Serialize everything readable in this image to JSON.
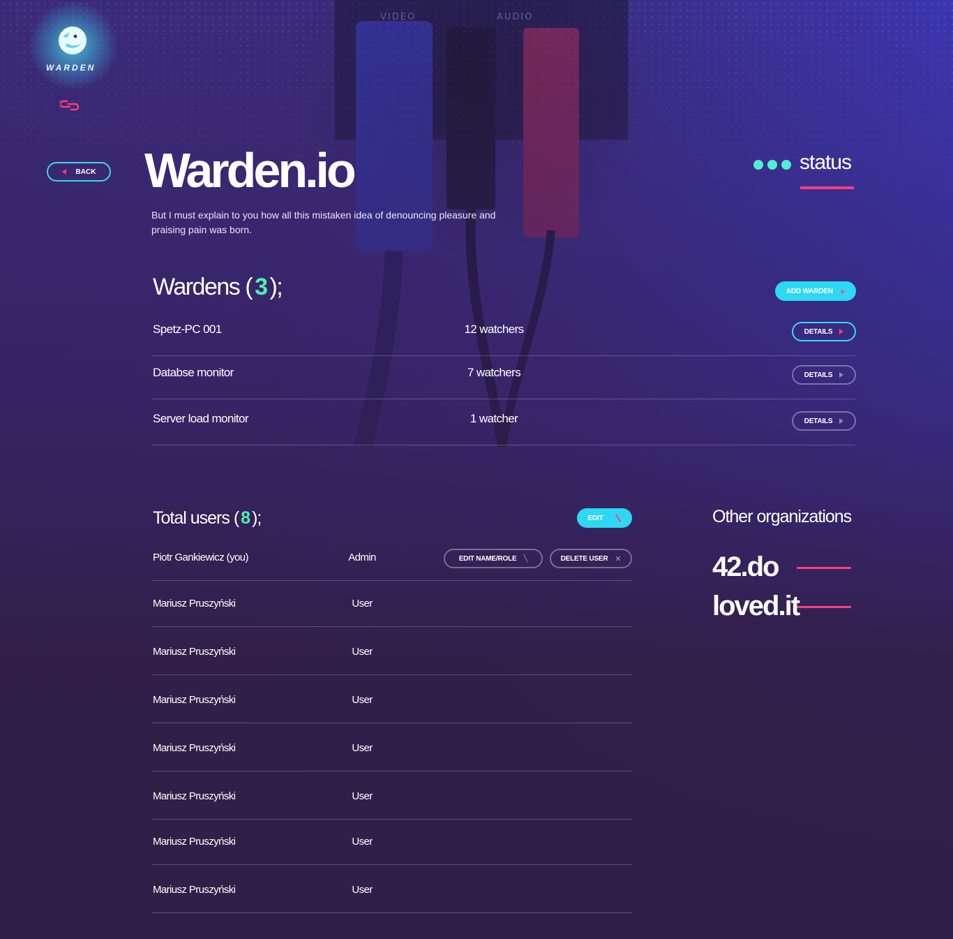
{
  "brand": {
    "name": "WARDEN"
  },
  "nav": {
    "back_label": "BACK"
  },
  "header": {
    "title": "Warden.io",
    "description": "But I must explain to you how all this mistaken idea of denouncing pleasure and praising pain was born.",
    "status_label": "status"
  },
  "photo_labels": {
    "video": "VIDEO",
    "audio": "AUDIO"
  },
  "wardens": {
    "title": "Wardens (",
    "count": "3",
    "title_suffix": ");",
    "add_label": "ADD WARDEN",
    "items": [
      {
        "name": "Spetz-PC 001",
        "watchers": "12 watchers",
        "action": "DETAILS"
      },
      {
        "name": "Databse monitor",
        "watchers": "7 watchers",
        "action": "DETAILS"
      },
      {
        "name": "Server load monitor",
        "watchers": "1 watcher",
        "action": "DETAILS"
      }
    ]
  },
  "users": {
    "title": "Total users (",
    "count": "8",
    "title_suffix": ");",
    "edit_label": "EDIT",
    "edit_name_role_label": "EDIT NAME/ROLE",
    "delete_user_label": "DELETE USER",
    "items": [
      {
        "name": "Piotr Gankiewicz (you)",
        "role": "Admin"
      },
      {
        "name": "Mariusz Pruszyński",
        "role": "User"
      },
      {
        "name": "Mariusz Pruszyński",
        "role": "User"
      },
      {
        "name": "Mariusz Pruszyński",
        "role": "User"
      },
      {
        "name": "Mariusz Pruszyński",
        "role": "User"
      },
      {
        "name": "Mariusz Pruszyński",
        "role": "User"
      },
      {
        "name": "Mariusz Pruszyński",
        "role": "User"
      },
      {
        "name": "Mariusz Pruszyński",
        "role": "User"
      }
    ]
  },
  "organizations": {
    "title": "Other organizations",
    "items": [
      "42.do",
      "loved.it"
    ]
  },
  "colors": {
    "accent_cyan": "#2ed8f2",
    "accent_pink": "#ff3d7f",
    "accent_green": "#4ff0b0",
    "background": "#3b2e88"
  },
  "icons": {
    "logo": "bird-logo-icon",
    "link": "link-icon",
    "back": "triangle-left-icon",
    "details": "triangle-right-icon",
    "add": "plus-icon",
    "edit": "pencil-icon",
    "delete": "close-icon"
  }
}
